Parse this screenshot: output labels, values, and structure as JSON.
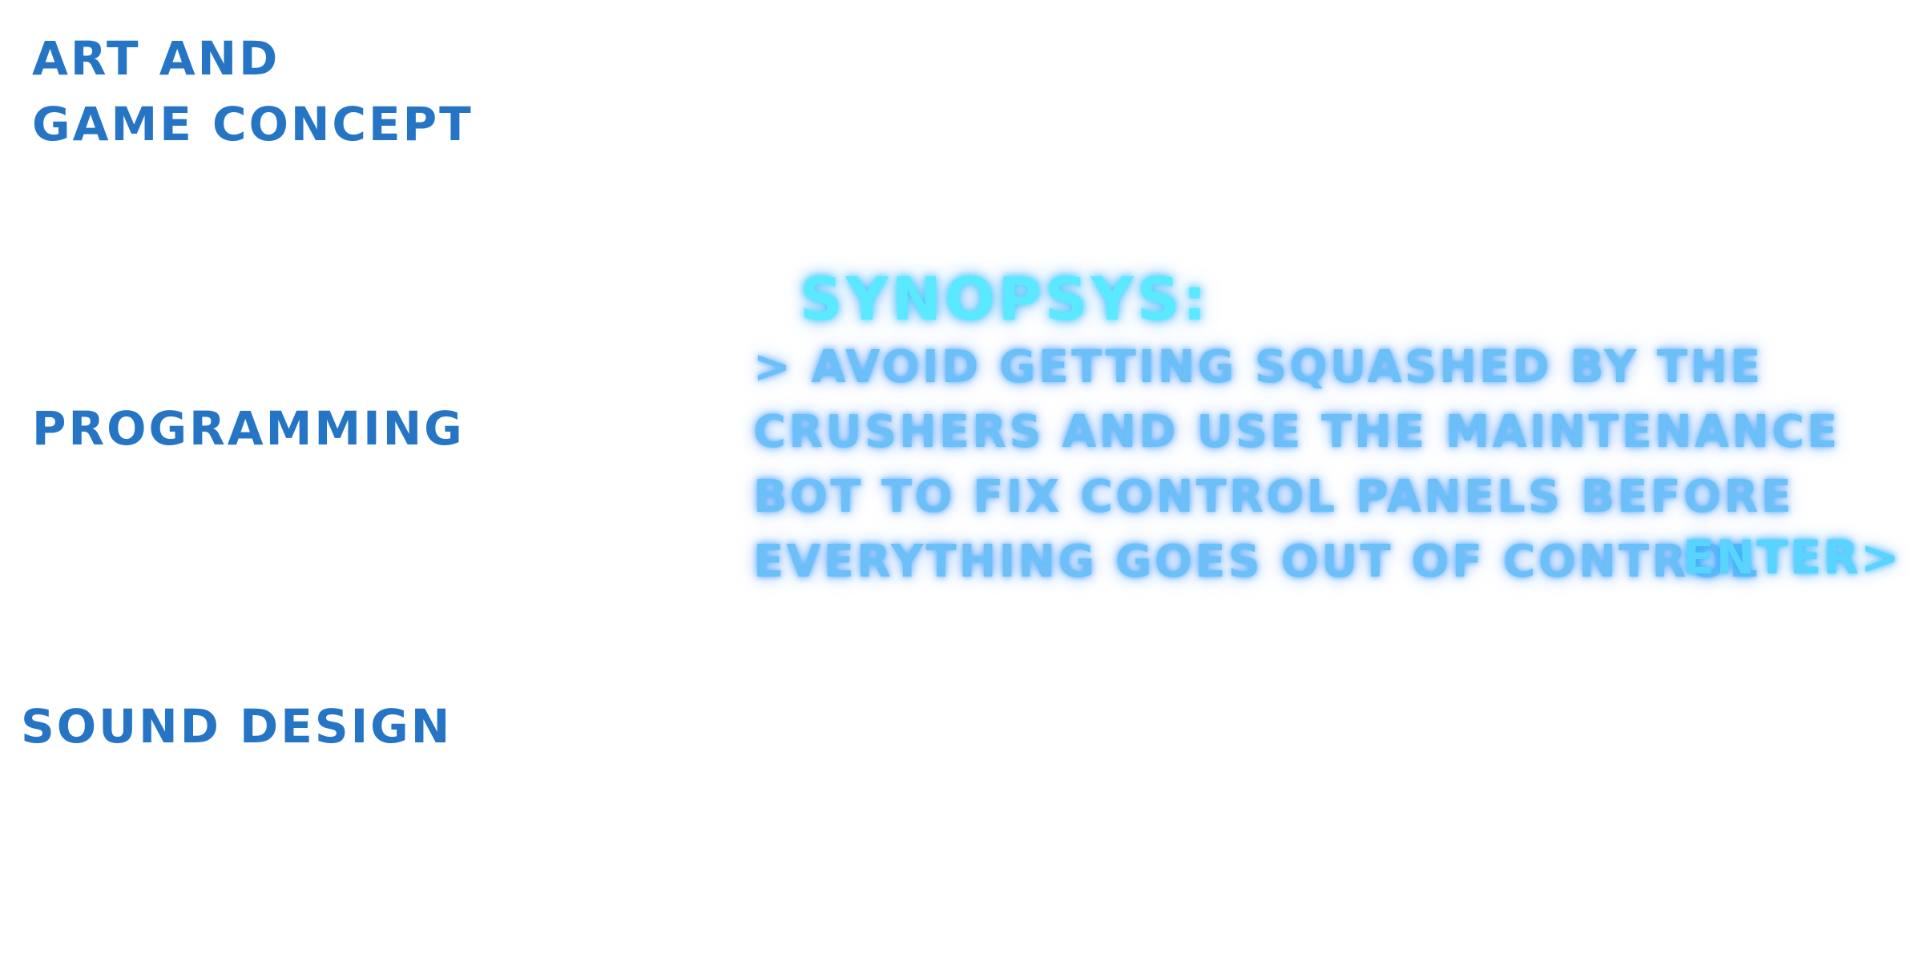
{
  "credits": {
    "art": {
      "line1": "ART AND",
      "line2": "GAME CONCEPT"
    },
    "programming": "PROGRAMMING",
    "sound": "SOUND DESIGN"
  },
  "synopsis": {
    "title": "SYNOPSYS:",
    "lines": [
      "> AVOID GETTING SQUASHED BY THE",
      "CRUSHERS AND USE THE MAINTENANCE",
      "BOT TO FIX CONTROL PANELS BEFORE",
      "EVERYTHING GOES OUT OF CONTROL"
    ]
  },
  "enter_button": {
    "label": "ENTER>"
  },
  "colors": {
    "credit_text": "#2575c4",
    "title_glow": "#5ae9ff",
    "body_glow": "#6cc0f7",
    "background": "#ffffff"
  }
}
